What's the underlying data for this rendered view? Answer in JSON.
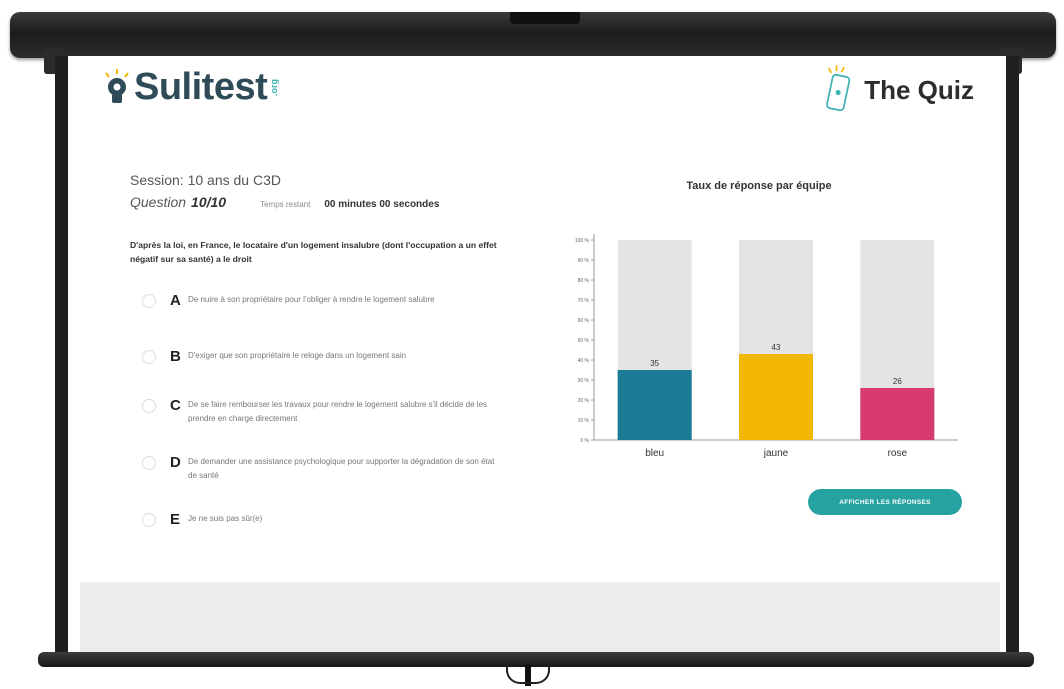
{
  "header": {
    "logo_text": "Sulitest",
    "logo_suffix": ".org",
    "quiz_title": "The Quiz"
  },
  "session": {
    "label": "Session: 10 ans du C3D",
    "question_label": "Question",
    "question_number": "10/10",
    "timer_label": "Temps restant",
    "timer_value": "00 minutes 00 secondes"
  },
  "question": {
    "text": "D'après la loi, en France, le locataire d'un logement insalubre (dont l'occupation a un effet négatif sur sa santé) a le droit",
    "answers": [
      {
        "letter": "A",
        "text": "De nuire à son propriétaire pour l'obliger à rendre le logement salubre"
      },
      {
        "letter": "B",
        "text": "D'exiger que son propriétaire le reloge dans un logement sain"
      },
      {
        "letter": "C",
        "text": "De se faire rembourser les travaux pour rendre le logement salubre s'il décide de les prendre en charge directement"
      },
      {
        "letter": "D",
        "text": "De demander une assistance psychologique pour supporter la dégradation de son état de santé"
      },
      {
        "letter": "E",
        "text": "Je ne suis pas sûr(e)"
      }
    ]
  },
  "chart_data": {
    "type": "bar",
    "title": "Taux de réponse par équipe",
    "categories": [
      "bleu",
      "jaune",
      "rose"
    ],
    "values": [
      35,
      43,
      26
    ],
    "data_labels": [
      "35",
      "43",
      "26"
    ],
    "colors": [
      "#1a7c94",
      "#f2b705",
      "#d63a6e"
    ],
    "background_bar_color": "#e4e4e4",
    "ylim": [
      0,
      100
    ],
    "yticks": [
      "0 %",
      "10 %",
      "20 %",
      "30 %",
      "40 %",
      "50 %",
      "60 %",
      "70 %",
      "80 %",
      "90 %",
      "100 %"
    ]
  },
  "actions": {
    "reveal_label": "AFFICHER LES RÉPONSES"
  }
}
